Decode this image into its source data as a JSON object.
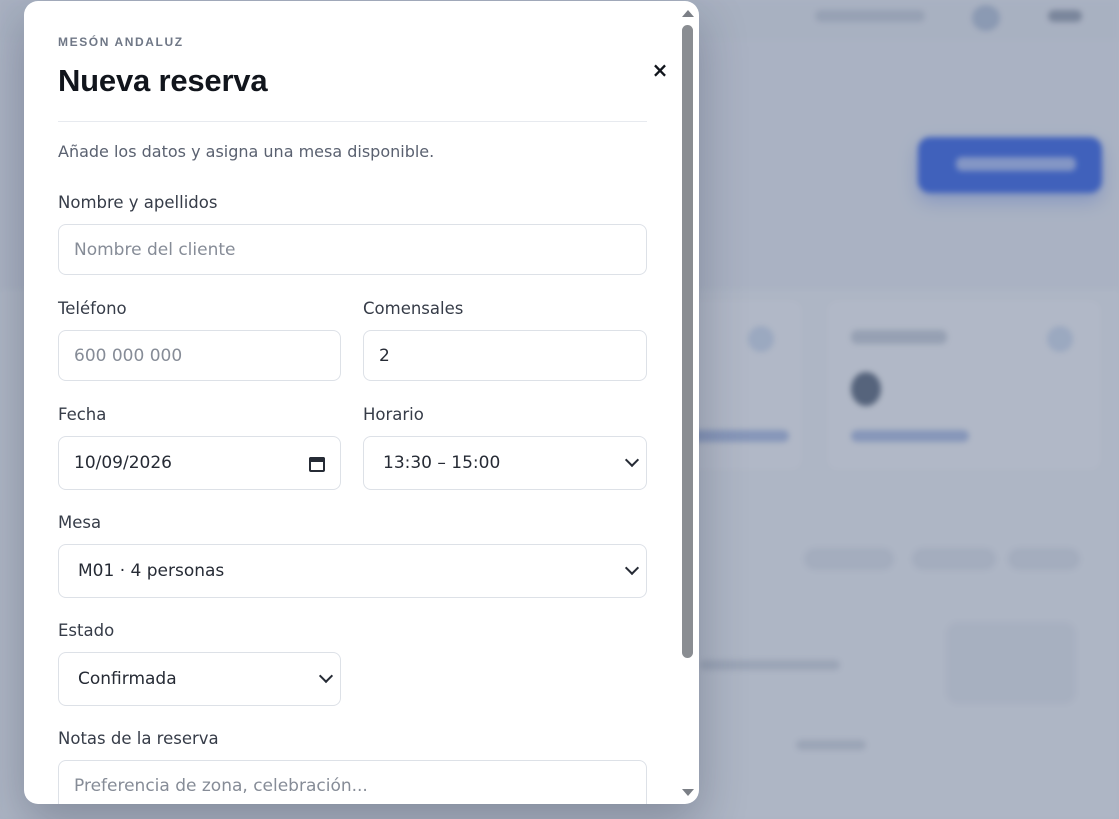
{
  "modal": {
    "eyebrow": "MESÓN ANDALUZ",
    "title": "Nueva reserva",
    "close_label": "×",
    "subtitle": "Añade los datos y asigna una mesa disponible."
  },
  "form": {
    "name": {
      "label": "Nombre y apellidos",
      "placeholder": "Nombre del cliente",
      "value": ""
    },
    "phone": {
      "label": "Teléfono",
      "placeholder": "600 000 000",
      "value": ""
    },
    "guests": {
      "label": "Comensales",
      "value": "2"
    },
    "date": {
      "label": "Fecha",
      "value": "10/09/2026"
    },
    "time": {
      "label": "Horario",
      "value": "13:30 – 15:00"
    },
    "table": {
      "label": "Mesa",
      "value": "M01 · 4 personas"
    },
    "status": {
      "label": "Estado",
      "value": "Confirmada"
    },
    "notes": {
      "label": "Notas de la reserva",
      "placeholder": "Preferencia de zona, celebración..."
    }
  },
  "icons": {
    "close": "close-icon",
    "calendar": "calendar-icon",
    "chevron": "chevron-down-icon"
  },
  "colors": {
    "primary": "#3c68e6",
    "scrim": "#46587a"
  }
}
